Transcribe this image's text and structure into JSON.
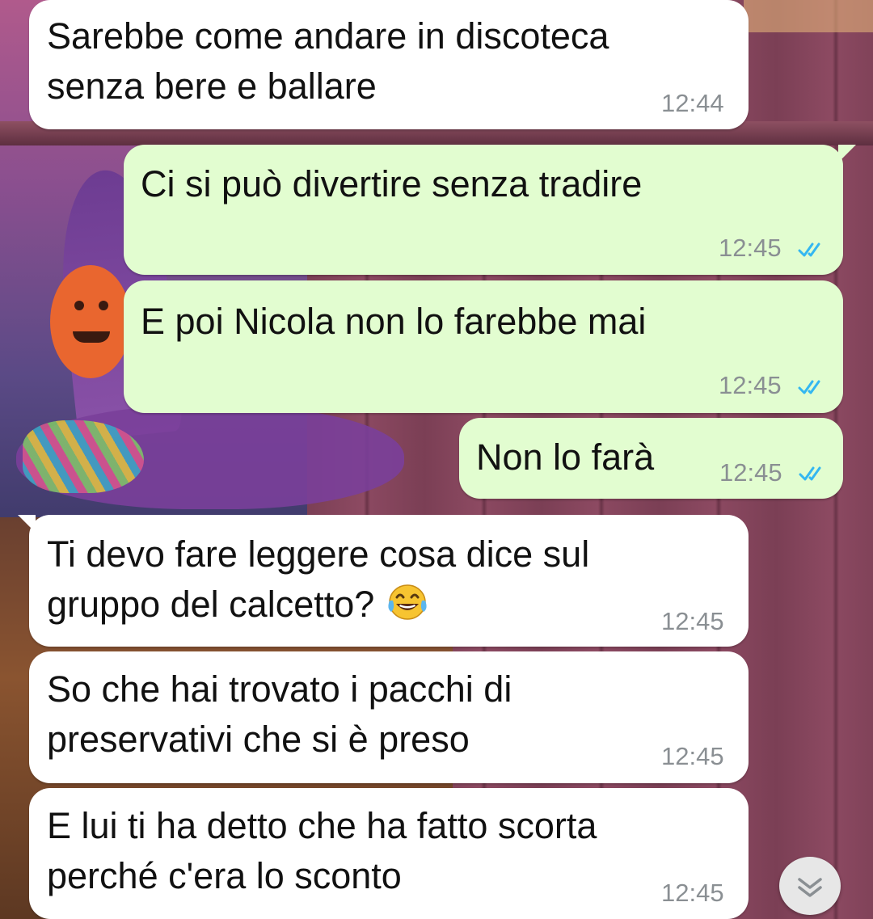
{
  "messages": [
    {
      "direction": "incoming",
      "text": "Sarebbe come andare in discoteca\nsenza bere e ballare",
      "time": "12:44"
    },
    {
      "direction": "outgoing",
      "text": "Ci si può divertire senza tradire",
      "time": "12:45",
      "status": "read"
    },
    {
      "direction": "outgoing",
      "text": "E poi Nicola non lo farebbe mai",
      "time": "12:45",
      "status": "read"
    },
    {
      "direction": "outgoing",
      "text": "Non lo farà",
      "time": "12:45",
      "status": "read"
    },
    {
      "direction": "incoming",
      "text": "Ti devo fare leggere cosa dice sul\ngruppo del calcetto?",
      "emoji": "face-with-tears-of-joy",
      "time": "12:45"
    },
    {
      "direction": "incoming",
      "text": "So che hai trovato i pacchi di\npreservativi che si è preso",
      "time": "12:45"
    },
    {
      "direction": "incoming",
      "text": "E lui ti ha detto che ha fatto scorta\nperché c'era lo sconto",
      "time": "12:45"
    }
  ],
  "colors": {
    "incoming_bubble": "#ffffff",
    "outgoing_bubble": "#e2fdd0",
    "read_ticks": "#34b7f1",
    "timestamp": "#8a8f93"
  },
  "scroll_button": {
    "icon": "double-chevron-down-icon"
  }
}
